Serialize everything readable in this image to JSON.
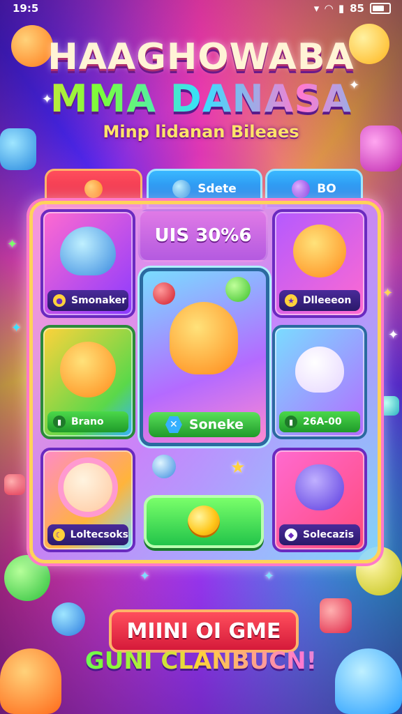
{
  "status_bar": {
    "time": "19:5",
    "battery_text": "85"
  },
  "header": {
    "title_line1": "HAAGHOWABA",
    "title_line2": "MMA DANASA",
    "subtitle": "Minp lidanan Bileaes"
  },
  "tabs": [
    {
      "label": "",
      "icon": "smiley-icon"
    },
    {
      "label": "Sdete",
      "icon": "blue-orb-icon"
    },
    {
      "label": "BO",
      "icon": "purple-orb-icon"
    }
  ],
  "score_box": {
    "text": "UIS 30%6"
  },
  "cards": [
    {
      "label": "Smonaker",
      "icon": "coin-badge-icon",
      "creature": "blue-fish-character"
    },
    {
      "label": "Dlleeeon",
      "icon": "star-badge-icon",
      "creature": "orange-sun-character"
    },
    {
      "label": "Brano",
      "icon": "shield-badge-icon",
      "creature": "orange-sun-character"
    },
    {
      "label": "26A-00",
      "icon": "shield-badge-icon",
      "creature": "white-cat-character"
    },
    {
      "label": "Loltecsoks",
      "icon": "moon-badge-icon",
      "creature": "flower-face-character"
    },
    {
      "label": "Solecazis",
      "icon": "gem-badge-icon",
      "creature": "purple-blob-character"
    }
  ],
  "center_card": {
    "label": "Soneke",
    "creature": "orange-hero-character"
  },
  "play_button": {
    "icon": "gold-coin-icon"
  },
  "bottom": {
    "banner": "MIINI OI GME",
    "tagline": "GUNI CLANBUCN!"
  },
  "colors": {
    "accent": "#ffd23b",
    "primary_red": "#e52a4a",
    "primary_blue": "#1d6fe0",
    "green": "#22c44a"
  }
}
